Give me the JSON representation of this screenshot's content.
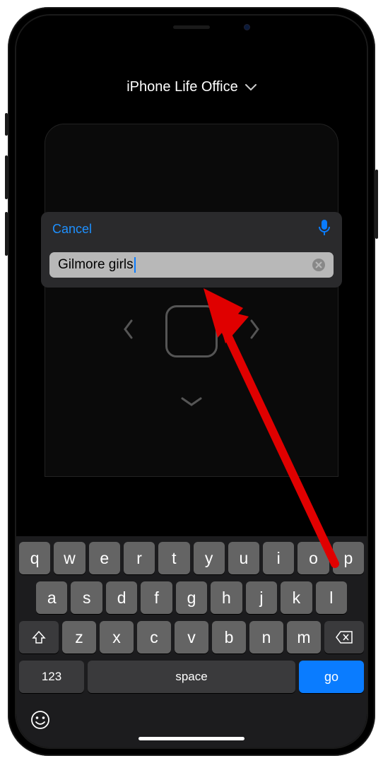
{
  "header": {
    "title": "iPhone Life Office"
  },
  "search": {
    "cancel_label": "Cancel",
    "value": "Gilmore girls"
  },
  "keyboard": {
    "row1": [
      "q",
      "w",
      "e",
      "r",
      "t",
      "y",
      "u",
      "i",
      "o",
      "p"
    ],
    "row2": [
      "a",
      "s",
      "d",
      "f",
      "g",
      "h",
      "j",
      "k",
      "l"
    ],
    "row3": [
      "z",
      "x",
      "c",
      "v",
      "b",
      "n",
      "m"
    ],
    "numeric_label": "123",
    "space_label": "space",
    "go_label": "go"
  }
}
